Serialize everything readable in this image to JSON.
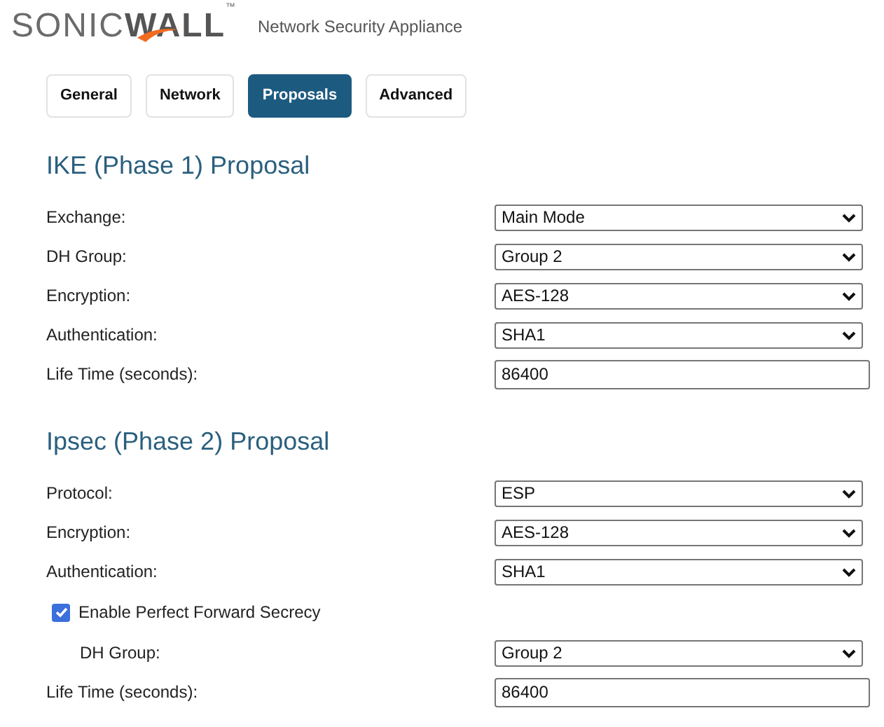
{
  "header": {
    "logo": {
      "light": "SONIC",
      "bold": "WALL",
      "mark": "™"
    },
    "subtitle": "Network Security Appliance"
  },
  "tabs": [
    {
      "label": "General",
      "selected": false
    },
    {
      "label": "Network",
      "selected": false
    },
    {
      "label": "Proposals",
      "selected": true
    },
    {
      "label": "Advanced",
      "selected": false
    }
  ],
  "sections": [
    {
      "title": "IKE (Phase 1) Proposal",
      "rows": [
        {
          "kind": "select",
          "label": "Exchange:",
          "value": "Main Mode"
        },
        {
          "kind": "select",
          "label": "DH Group:",
          "value": "Group 2"
        },
        {
          "kind": "select",
          "label": "Encryption:",
          "value": "AES-128"
        },
        {
          "kind": "select",
          "label": "Authentication:",
          "value": "SHA1"
        },
        {
          "kind": "text",
          "label": "Life Time (seconds):",
          "value": "86400"
        }
      ]
    },
    {
      "title": "Ipsec (Phase 2) Proposal",
      "rows": [
        {
          "kind": "select",
          "label": "Protocol:",
          "value": "ESP"
        },
        {
          "kind": "select",
          "label": "Encryption:",
          "value": "AES-128"
        },
        {
          "kind": "select",
          "label": "Authentication:",
          "value": "SHA1"
        },
        {
          "kind": "checkbox",
          "label": "Enable Perfect Forward Secrecy",
          "checked": true,
          "children": [
            {
              "kind": "select",
              "label": "DH Group:",
              "value": "Group 2"
            }
          ]
        },
        {
          "kind": "text",
          "label": "Life Time (seconds):",
          "value": "86400"
        }
      ]
    }
  ]
}
